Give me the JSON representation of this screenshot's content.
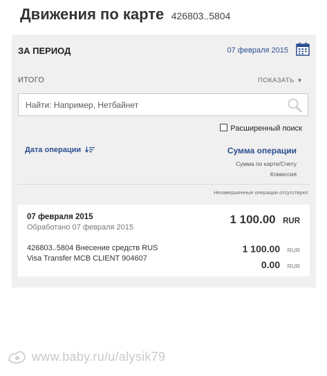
{
  "header": {
    "title": "Движения по карте",
    "card_mask": "426803..5804"
  },
  "period": {
    "label": "ЗА ПЕРИОД",
    "date": "07 февраля 2015",
    "calendar_icon": "calendar-icon"
  },
  "summary": {
    "label": "ИТОГО",
    "show_label": "ПОКАЗАТЬ",
    "show_icon": "caret-down-icon"
  },
  "search": {
    "placeholder": "Найти: Например, Нетбайнет",
    "value": "",
    "icon": "search-icon"
  },
  "advanced": {
    "label": "Расширенный поиск",
    "checked": false
  },
  "columns": {
    "date_header": "Дата операции",
    "sort_icon": "sort-desc-icon",
    "amount_header": "Сумма операции",
    "amount_sub1": "Сумма по карте/Счету",
    "amount_sub2": "Комиссия"
  },
  "notice": "Незавершенные операции отсутствуют",
  "operation": {
    "date": "07 февраля 2015",
    "processed": "Обработано 07 февраля 2015",
    "total": "1 100.00",
    "total_currency": "RUR",
    "desc_line1": "426803..5804 Внесение средств RUS",
    "desc_line2": "Visa Transfer MCB CLIENT 904607",
    "card_amount": "1 100.00",
    "card_currency": "RUR",
    "commission": "0.00",
    "commission_currency": "RUR"
  },
  "watermark": {
    "text": "www.baby.ru/u/alysik79",
    "logo_icon": "baby-ru-logo-icon"
  },
  "colors": {
    "link": "#2a4e8f",
    "panel": "#f0f0f0",
    "card": "#ffffff"
  }
}
